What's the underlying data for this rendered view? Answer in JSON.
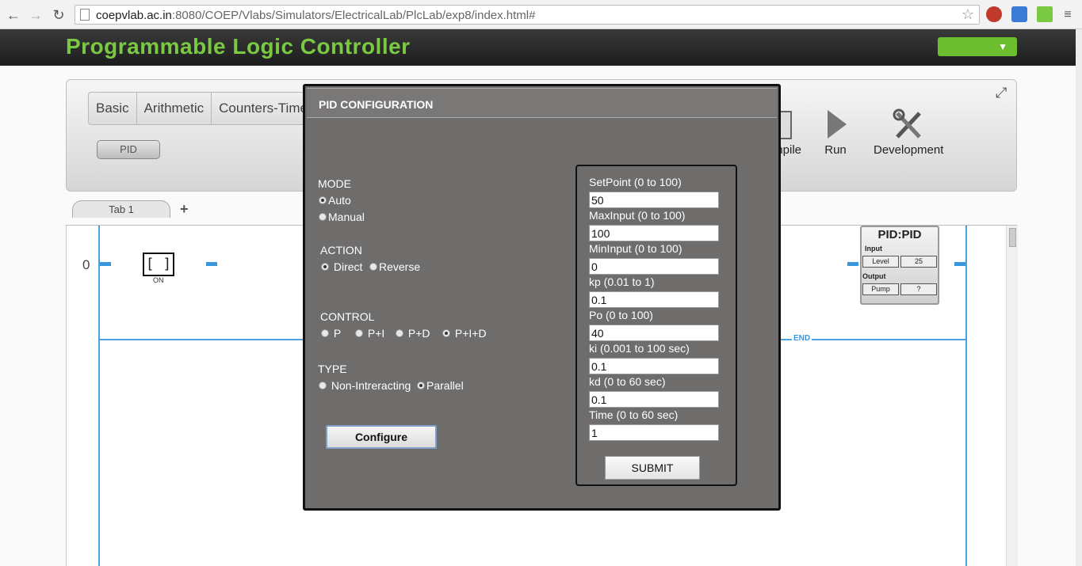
{
  "browser": {
    "url_host": "coepvlab.ac.in",
    "url_rest": ":8080/COEP/Vlabs/Simulators/ElectricalLab/PlcLab/exp8/index.html#"
  },
  "app": {
    "title": "Programmable Logic Controller",
    "accent": "#7ac943"
  },
  "toolbar": {
    "tabs": [
      "Basic",
      "Arithmetic",
      "Counters-Timers"
    ],
    "pid_button": "PID",
    "tools": {
      "compile": "Compile",
      "run": "Run",
      "development": "Development"
    }
  },
  "sheet": {
    "tab_label": "Tab 1",
    "add_symbol": "+"
  },
  "ladder": {
    "rung_number": "0",
    "contact_symbol": "[ ]",
    "contact_label": "ON",
    "end_label": "END",
    "pid_block": {
      "title": "PID:PID",
      "input_label": "Input",
      "input_name": "Level",
      "input_value": "25",
      "output_label": "Output",
      "output_name": "Pump",
      "output_value": "?"
    }
  },
  "modal": {
    "title": "PID CONFIGURATION",
    "mode": {
      "heading": "MODE",
      "options": [
        "Auto",
        "Manual"
      ],
      "selected": "Auto"
    },
    "action": {
      "heading": "ACTION",
      "options": [
        "Direct",
        "Reverse"
      ],
      "selected": "Direct"
    },
    "control": {
      "heading": "CONTROL",
      "options": [
        "P",
        "P+I",
        "P+D",
        "P+I+D"
      ],
      "selected": "P+I+D"
    },
    "type": {
      "heading": "TYPE",
      "options": [
        "Non-Intreracting",
        "Parallel"
      ],
      "selected": "Parallel"
    },
    "configure_button": "Configure",
    "params": [
      {
        "label": "SetPoint (0 to 100)",
        "value": "50"
      },
      {
        "label": "MaxInput (0 to 100)",
        "value": "100"
      },
      {
        "label": "MinInput (0 to 100)",
        "value": "0"
      },
      {
        "label": "kp (0.01 to 1)",
        "value": "0.1"
      },
      {
        "label": "Po (0 to 100)",
        "value": "40"
      },
      {
        "label": "ki (0.001 to 100 sec)",
        "value": "0.1"
      },
      {
        "label": "kd (0 to 60 sec)",
        "value": "0.1"
      },
      {
        "label": "Time (0 to 60 sec)",
        "value": "1"
      }
    ],
    "submit_button": "SUBMIT"
  }
}
